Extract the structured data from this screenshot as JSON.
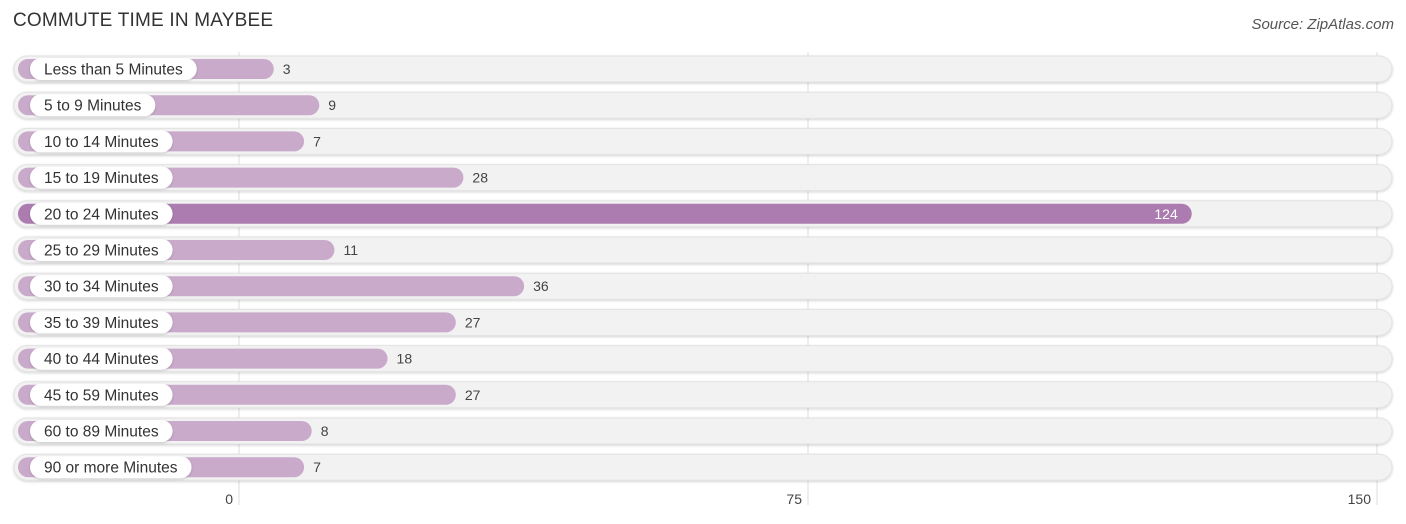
{
  "chart_data": {
    "type": "bar",
    "orientation": "horizontal",
    "title": "COMMUTE TIME IN MAYBEE",
    "source": "Source: ZipAtlas.com",
    "categories": [
      "Less than 5 Minutes",
      "5 to 9 Minutes",
      "10 to 14 Minutes",
      "15 to 19 Minutes",
      "20 to 24 Minutes",
      "25 to 29 Minutes",
      "30 to 34 Minutes",
      "35 to 39 Minutes",
      "40 to 44 Minutes",
      "45 to 59 Minutes",
      "60 to 89 Minutes",
      "90 or more Minutes"
    ],
    "values": [
      3,
      9,
      7,
      28,
      124,
      11,
      36,
      27,
      18,
      27,
      8,
      7
    ],
    "xlim": [
      0,
      150
    ],
    "xticks": [
      0,
      75,
      150
    ],
    "xlabel": "",
    "ylabel": "",
    "grid": true,
    "highlight_index": 4,
    "colors": {
      "bar": "#c9aacb",
      "highlight": "#ac7cb0",
      "track": "#f2f2f2"
    }
  }
}
